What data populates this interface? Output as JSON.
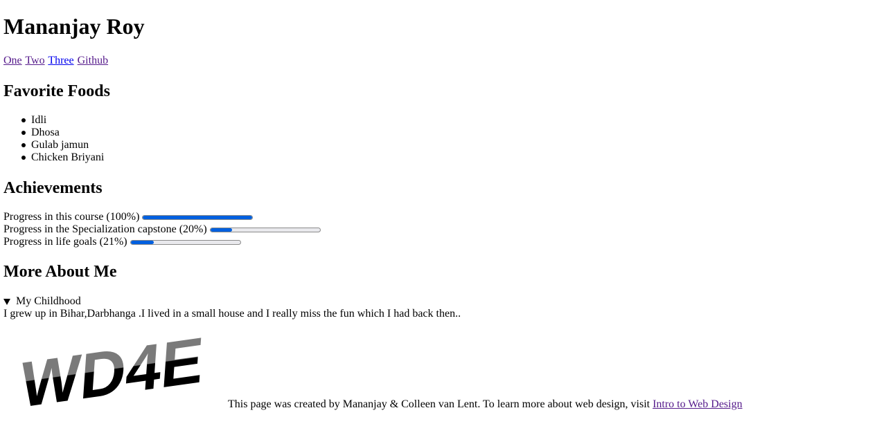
{
  "header": {
    "title": "Mananjay Roy"
  },
  "nav": {
    "links": [
      {
        "label": "One",
        "visited": true
      },
      {
        "label": "Two",
        "visited": true
      },
      {
        "label": "Three",
        "visited": false
      },
      {
        "label": "Github",
        "visited": true
      }
    ]
  },
  "foods": {
    "heading": "Favorite Foods",
    "items": [
      "Idli",
      "Dhosa",
      "Gulab jamun",
      "Chicken Briyani"
    ]
  },
  "achievements": {
    "heading": "Achievements",
    "items": [
      {
        "label": "Progress in this course (100%)",
        "progress": 1.0
      },
      {
        "label": "Progress in the Specialization capstone (20%)",
        "progress": 0.2
      },
      {
        "label": "Progress in life goals (21%)",
        "progress": 0.21
      }
    ]
  },
  "about": {
    "heading": "More About Me",
    "summary": "My Childhood",
    "text": "I grew up in Bihar,Darbhanga .I lived in a small house and I really miss the fun which I had back then.."
  },
  "logo": {
    "text": "WD4E"
  },
  "footer": {
    "text": "This page was created by Mananjay & Colleen van Lent. To learn more about web design, visit ",
    "link_label": "Intro to Web Design"
  },
  "colors": {
    "progress_fill": "#0060df",
    "progress_track": "#e9e9ed",
    "link_visited": "#551a8b",
    "link_unvisited": "#0000ee"
  }
}
